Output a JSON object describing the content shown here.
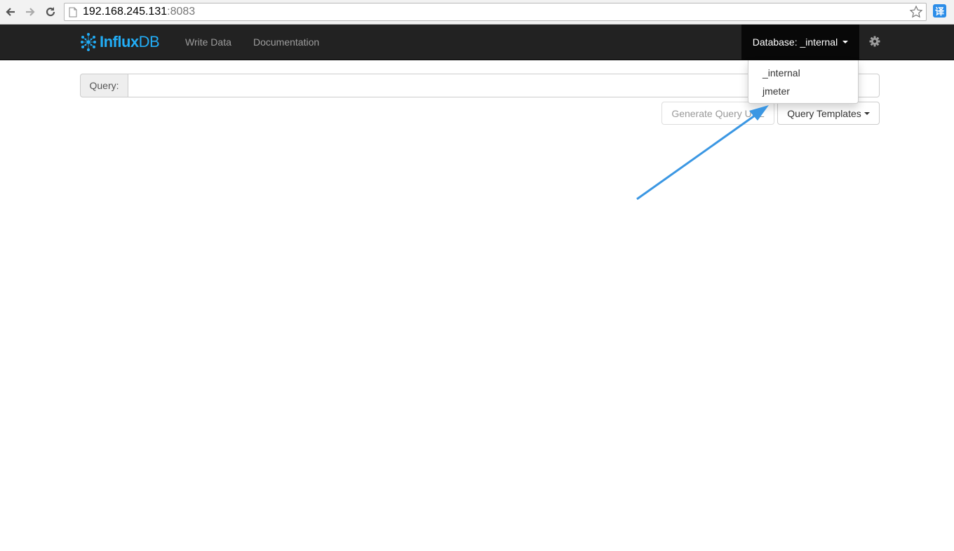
{
  "browser": {
    "url_host": "192.168.245.131",
    "url_port": ":8083",
    "translate_label": "译"
  },
  "navbar": {
    "brand": "InfluxDB",
    "brand_prefix": "Influx",
    "brand_suffix": "DB",
    "links": [
      "Write Data",
      "Documentation"
    ],
    "database_label": "Database: _internal"
  },
  "database_dropdown": {
    "options": [
      "_internal",
      "jmeter"
    ]
  },
  "query": {
    "label": "Query:",
    "value": ""
  },
  "buttons": {
    "generate_url": "Generate Query URL",
    "templates": "Query Templates"
  },
  "colors": {
    "navbar_bg": "#222222",
    "brand": "#22adf6",
    "annotation_arrow": "#3b97e3"
  }
}
